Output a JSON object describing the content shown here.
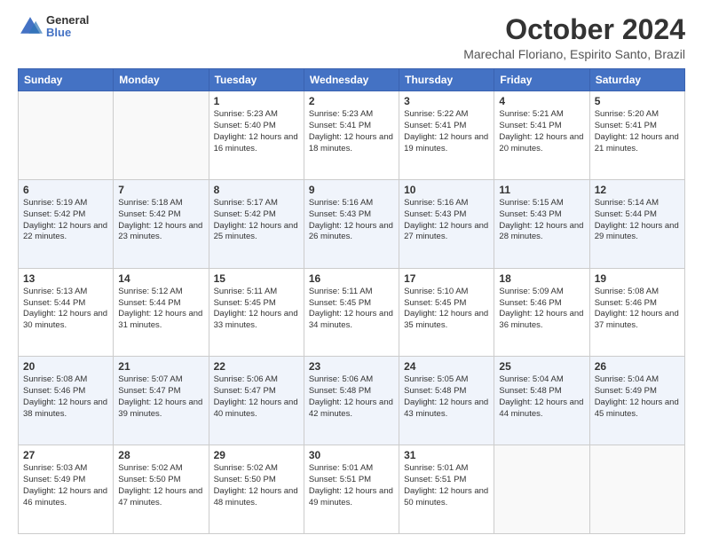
{
  "logo": {
    "line1": "General",
    "line2": "Blue"
  },
  "header": {
    "month": "October 2024",
    "location": "Marechal Floriano, Espirito Santo, Brazil"
  },
  "weekdays": [
    "Sunday",
    "Monday",
    "Tuesday",
    "Wednesday",
    "Thursday",
    "Friday",
    "Saturday"
  ],
  "weeks": [
    [
      {
        "day": "",
        "info": ""
      },
      {
        "day": "",
        "info": ""
      },
      {
        "day": "1",
        "info": "Sunrise: 5:23 AM\nSunset: 5:40 PM\nDaylight: 12 hours and 16 minutes."
      },
      {
        "day": "2",
        "info": "Sunrise: 5:23 AM\nSunset: 5:41 PM\nDaylight: 12 hours and 18 minutes."
      },
      {
        "day": "3",
        "info": "Sunrise: 5:22 AM\nSunset: 5:41 PM\nDaylight: 12 hours and 19 minutes."
      },
      {
        "day": "4",
        "info": "Sunrise: 5:21 AM\nSunset: 5:41 PM\nDaylight: 12 hours and 20 minutes."
      },
      {
        "day": "5",
        "info": "Sunrise: 5:20 AM\nSunset: 5:41 PM\nDaylight: 12 hours and 21 minutes."
      }
    ],
    [
      {
        "day": "6",
        "info": "Sunrise: 5:19 AM\nSunset: 5:42 PM\nDaylight: 12 hours and 22 minutes."
      },
      {
        "day": "7",
        "info": "Sunrise: 5:18 AM\nSunset: 5:42 PM\nDaylight: 12 hours and 23 minutes."
      },
      {
        "day": "8",
        "info": "Sunrise: 5:17 AM\nSunset: 5:42 PM\nDaylight: 12 hours and 25 minutes."
      },
      {
        "day": "9",
        "info": "Sunrise: 5:16 AM\nSunset: 5:43 PM\nDaylight: 12 hours and 26 minutes."
      },
      {
        "day": "10",
        "info": "Sunrise: 5:16 AM\nSunset: 5:43 PM\nDaylight: 12 hours and 27 minutes."
      },
      {
        "day": "11",
        "info": "Sunrise: 5:15 AM\nSunset: 5:43 PM\nDaylight: 12 hours and 28 minutes."
      },
      {
        "day": "12",
        "info": "Sunrise: 5:14 AM\nSunset: 5:44 PM\nDaylight: 12 hours and 29 minutes."
      }
    ],
    [
      {
        "day": "13",
        "info": "Sunrise: 5:13 AM\nSunset: 5:44 PM\nDaylight: 12 hours and 30 minutes."
      },
      {
        "day": "14",
        "info": "Sunrise: 5:12 AM\nSunset: 5:44 PM\nDaylight: 12 hours and 31 minutes."
      },
      {
        "day": "15",
        "info": "Sunrise: 5:11 AM\nSunset: 5:45 PM\nDaylight: 12 hours and 33 minutes."
      },
      {
        "day": "16",
        "info": "Sunrise: 5:11 AM\nSunset: 5:45 PM\nDaylight: 12 hours and 34 minutes."
      },
      {
        "day": "17",
        "info": "Sunrise: 5:10 AM\nSunset: 5:45 PM\nDaylight: 12 hours and 35 minutes."
      },
      {
        "day": "18",
        "info": "Sunrise: 5:09 AM\nSunset: 5:46 PM\nDaylight: 12 hours and 36 minutes."
      },
      {
        "day": "19",
        "info": "Sunrise: 5:08 AM\nSunset: 5:46 PM\nDaylight: 12 hours and 37 minutes."
      }
    ],
    [
      {
        "day": "20",
        "info": "Sunrise: 5:08 AM\nSunset: 5:46 PM\nDaylight: 12 hours and 38 minutes."
      },
      {
        "day": "21",
        "info": "Sunrise: 5:07 AM\nSunset: 5:47 PM\nDaylight: 12 hours and 39 minutes."
      },
      {
        "day": "22",
        "info": "Sunrise: 5:06 AM\nSunset: 5:47 PM\nDaylight: 12 hours and 40 minutes."
      },
      {
        "day": "23",
        "info": "Sunrise: 5:06 AM\nSunset: 5:48 PM\nDaylight: 12 hours and 42 minutes."
      },
      {
        "day": "24",
        "info": "Sunrise: 5:05 AM\nSunset: 5:48 PM\nDaylight: 12 hours and 43 minutes."
      },
      {
        "day": "25",
        "info": "Sunrise: 5:04 AM\nSunset: 5:48 PM\nDaylight: 12 hours and 44 minutes."
      },
      {
        "day": "26",
        "info": "Sunrise: 5:04 AM\nSunset: 5:49 PM\nDaylight: 12 hours and 45 minutes."
      }
    ],
    [
      {
        "day": "27",
        "info": "Sunrise: 5:03 AM\nSunset: 5:49 PM\nDaylight: 12 hours and 46 minutes."
      },
      {
        "day": "28",
        "info": "Sunrise: 5:02 AM\nSunset: 5:50 PM\nDaylight: 12 hours and 47 minutes."
      },
      {
        "day": "29",
        "info": "Sunrise: 5:02 AM\nSunset: 5:50 PM\nDaylight: 12 hours and 48 minutes."
      },
      {
        "day": "30",
        "info": "Sunrise: 5:01 AM\nSunset: 5:51 PM\nDaylight: 12 hours and 49 minutes."
      },
      {
        "day": "31",
        "info": "Sunrise: 5:01 AM\nSunset: 5:51 PM\nDaylight: 12 hours and 50 minutes."
      },
      {
        "day": "",
        "info": ""
      },
      {
        "day": "",
        "info": ""
      }
    ]
  ]
}
